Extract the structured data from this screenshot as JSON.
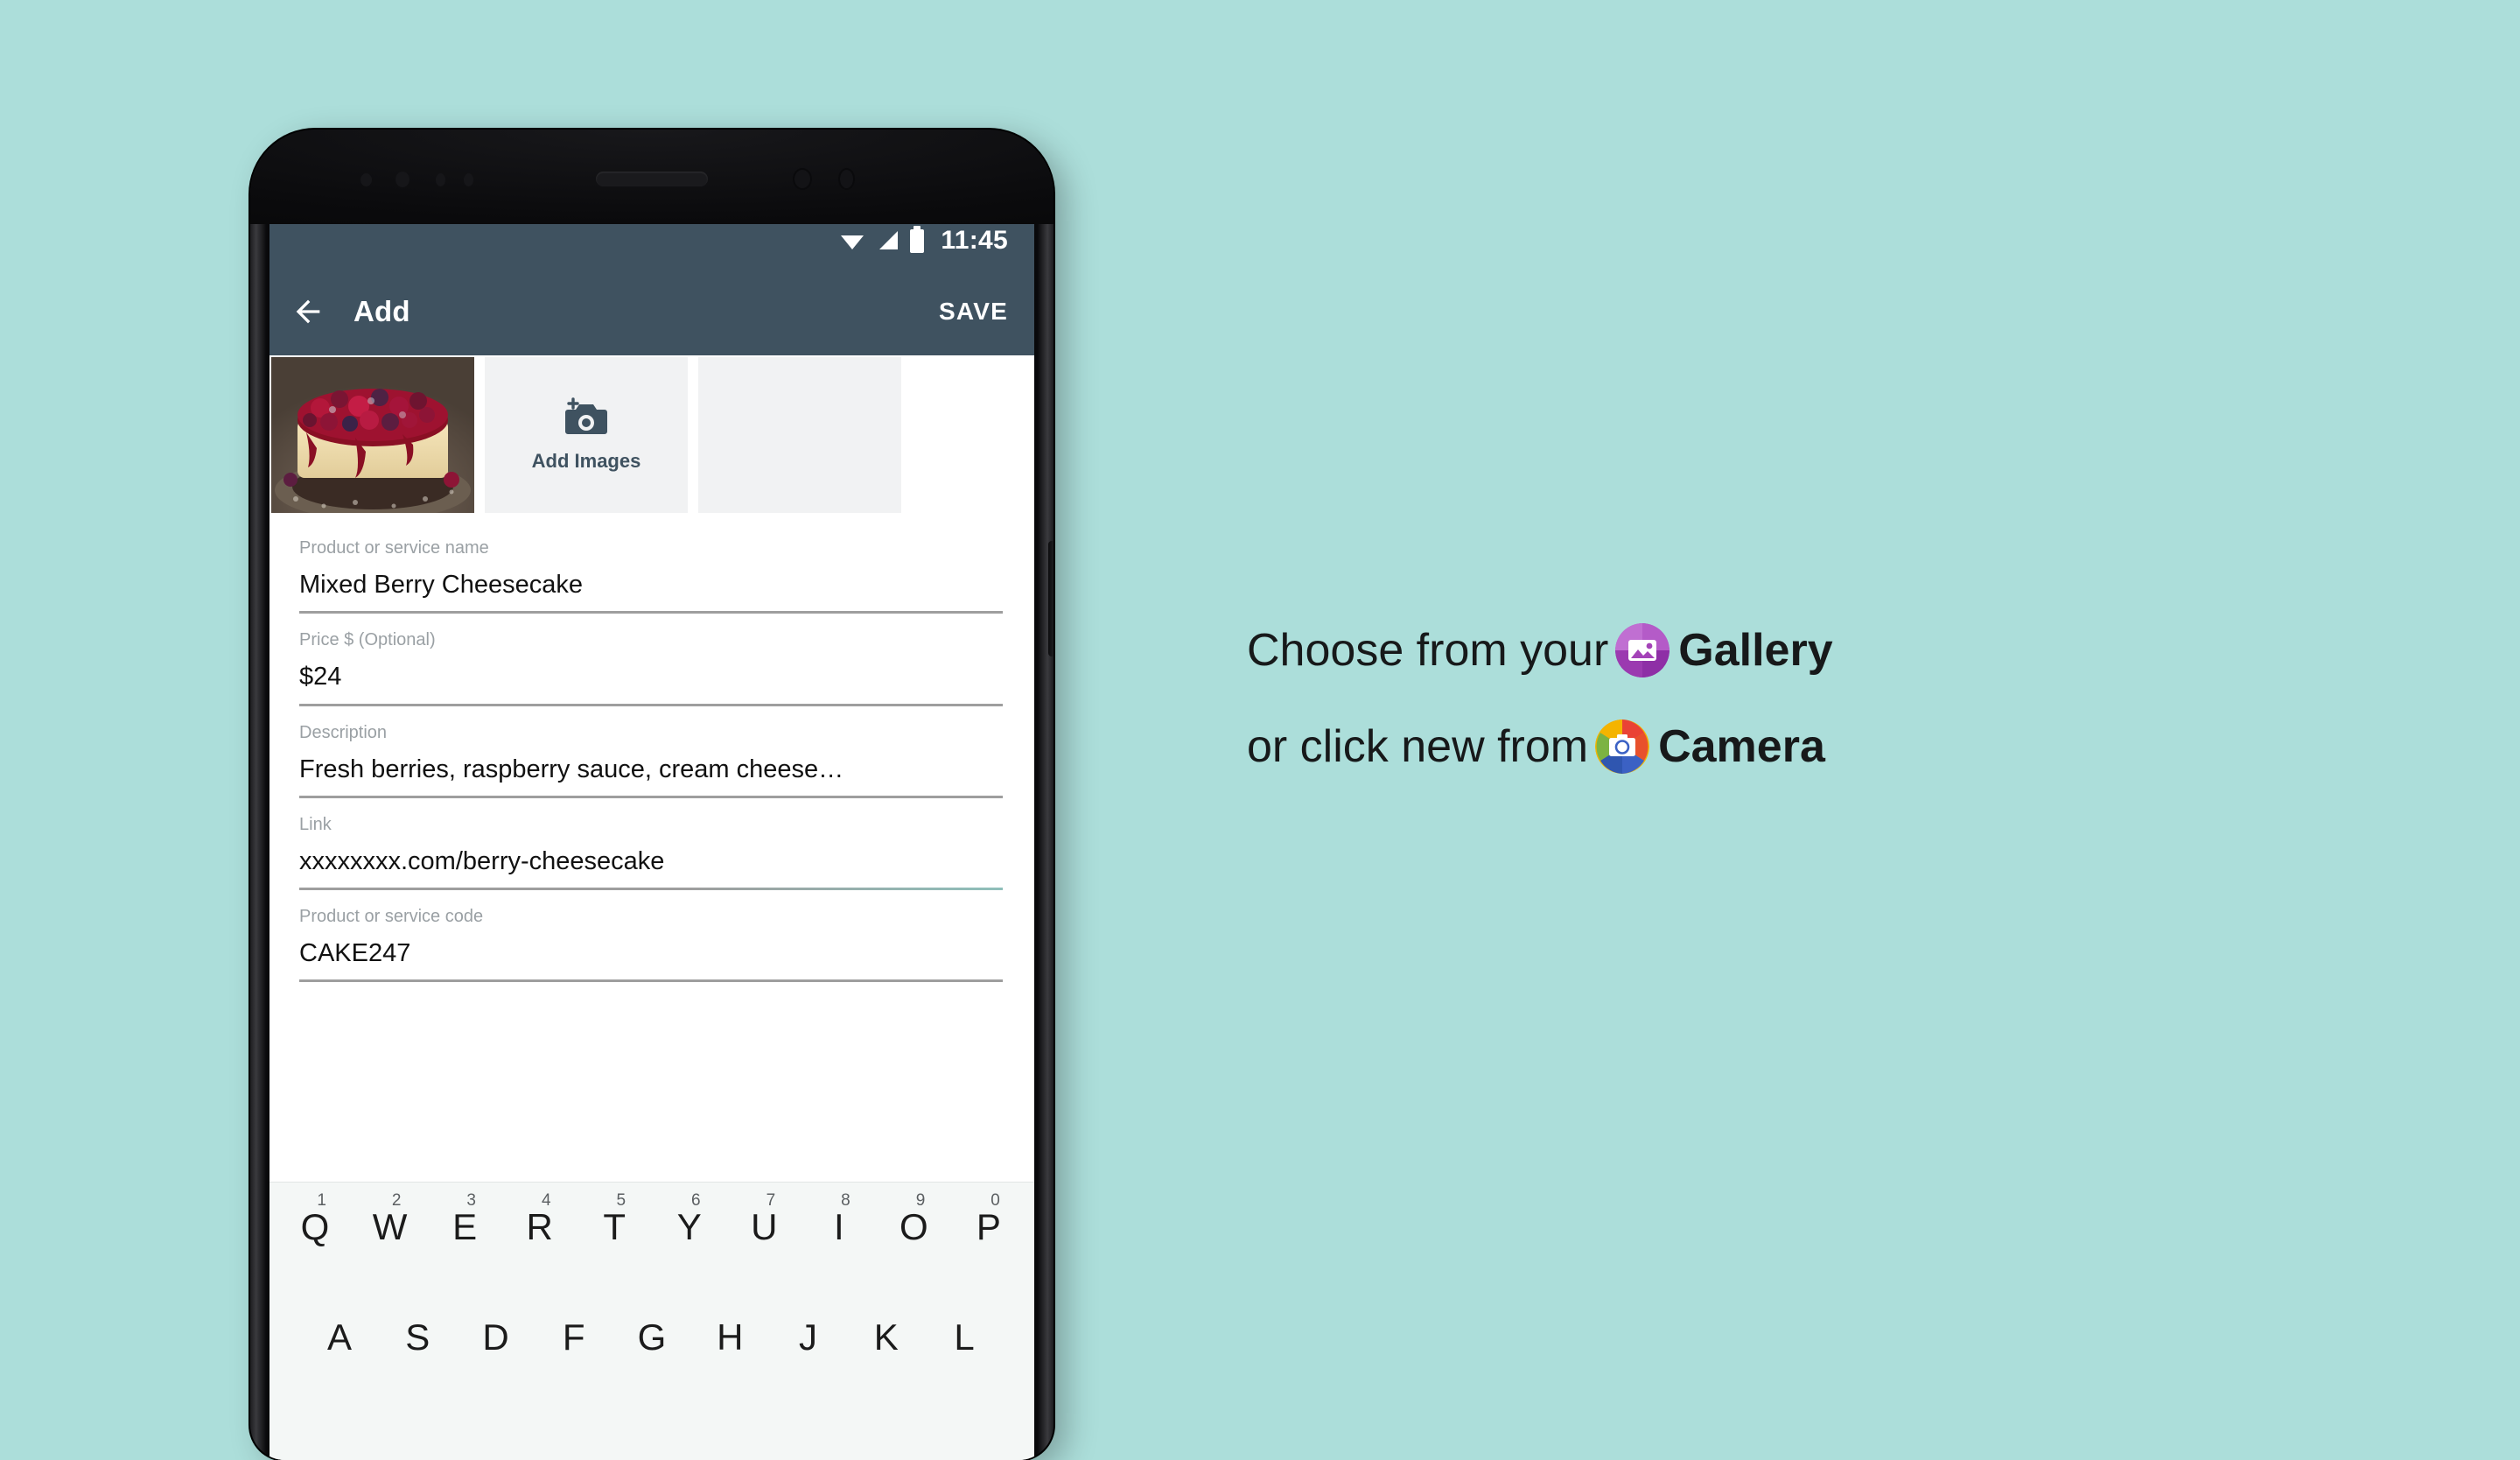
{
  "background_color": "#ACDEDA",
  "phone": {
    "statusbar": {
      "time": "11:45",
      "icons": [
        "wifi-icon",
        "cellular-signal-icon",
        "battery-icon"
      ],
      "background_color": "#3F5260"
    },
    "appbar": {
      "back_icon": "back-arrow-icon",
      "title": "Add",
      "save_label": "SAVE",
      "background_color": "#3F5260"
    },
    "image_strip": {
      "thumbnail_alt": "Mixed berry cheesecake photo",
      "add_images_label": "Add Images",
      "add_images_icon": "add-camera-icon"
    },
    "form": {
      "fields": [
        {
          "label": "Product or service name",
          "value": "Mixed Berry Cheesecake",
          "accent": false
        },
        {
          "label": "Price $ (Optional)",
          "value": "$24",
          "accent": false
        },
        {
          "label": "Description",
          "value": "Fresh berries, raspberry sauce, cream cheese…",
          "accent": false
        },
        {
          "label": "Link",
          "value": "xxxxxxxx.com/berry-cheesecake",
          "accent": true
        },
        {
          "label": "Product or service code",
          "value": "CAKE247",
          "accent": false
        }
      ]
    },
    "keyboard": {
      "row1": [
        {
          "num": "1",
          "char": "Q"
        },
        {
          "num": "2",
          "char": "W"
        },
        {
          "num": "3",
          "char": "E"
        },
        {
          "num": "4",
          "char": "R"
        },
        {
          "num": "5",
          "char": "T"
        },
        {
          "num": "6",
          "char": "Y"
        },
        {
          "num": "7",
          "char": "U"
        },
        {
          "num": "8",
          "char": "I"
        },
        {
          "num": "9",
          "char": "O"
        },
        {
          "num": "0",
          "char": "P"
        }
      ],
      "row2": [
        {
          "num": "",
          "char": "A"
        },
        {
          "num": "",
          "char": "S"
        },
        {
          "num": "",
          "char": "D"
        },
        {
          "num": "",
          "char": "F"
        },
        {
          "num": "",
          "char": "G"
        },
        {
          "num": "",
          "char": "H"
        },
        {
          "num": "",
          "char": "J"
        },
        {
          "num": "",
          "char": "K"
        },
        {
          "num": "",
          "char": "L"
        }
      ]
    }
  },
  "copy": {
    "line1_pre": "Choose from your",
    "line1_strong": "Gallery",
    "line1_icon": "google-photos-gallery-icon",
    "line2_pre": "or click new from",
    "line2_strong": "Camera",
    "line2_icon": "google-camera-icon"
  }
}
